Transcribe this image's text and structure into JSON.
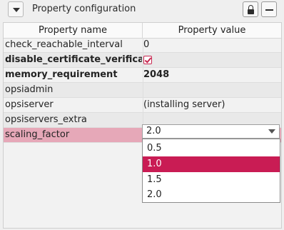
{
  "header": {
    "title": "Property configuration"
  },
  "table": {
    "columns": [
      "Property name",
      "Property value"
    ],
    "rows": [
      {
        "name": "check_reachable_interval",
        "value": "0"
      },
      {
        "name": "disable_certificate_verification",
        "value": ""
      },
      {
        "name": "memory_requirement",
        "value": "2048"
      },
      {
        "name": "opsiadmin",
        "value": ""
      },
      {
        "name": "opsiserver",
        "value": "(installing server)"
      },
      {
        "name": "opsiservers_extra",
        "value": ""
      },
      {
        "name": "scaling_factor",
        "value": "2.0"
      }
    ]
  },
  "dropdown": {
    "selected": "2.0",
    "options": [
      "0.5",
      "1.0",
      "1.5",
      "2.0"
    ],
    "highlighted": "1.0"
  },
  "colors": {
    "accent": "#c91c54",
    "selected_row": "#e6a8b8"
  }
}
